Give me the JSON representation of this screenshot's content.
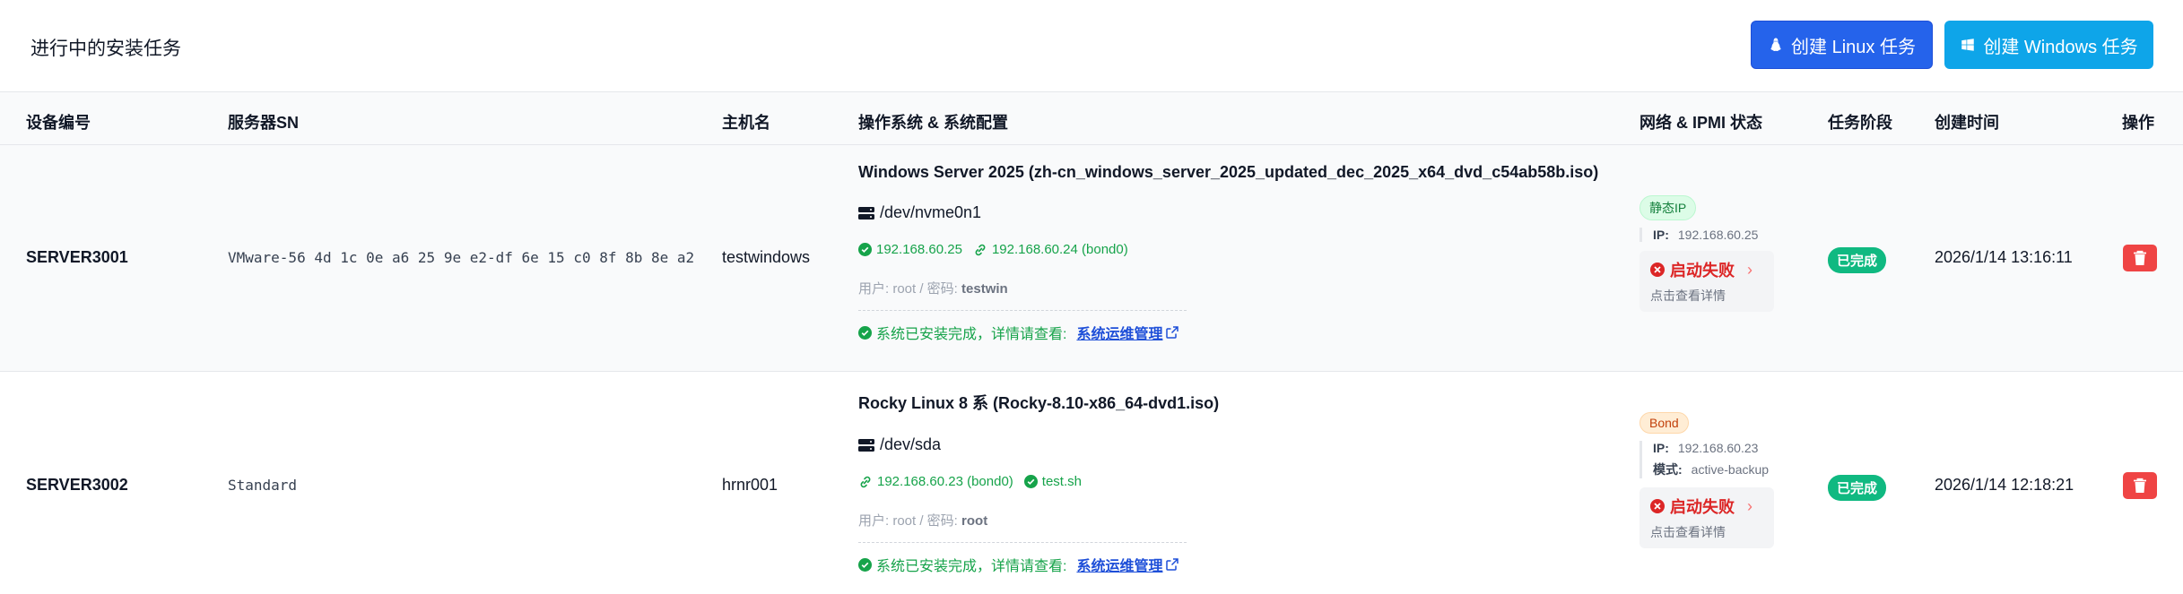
{
  "header": {
    "title": "进行中的安装任务",
    "create_linux_label": "创建 Linux 任务",
    "create_windows_label": "创建 Windows 任务"
  },
  "columns": [
    "设备编号",
    "服务器SN",
    "主机名",
    "操作系统 & 系统配置",
    "网络 & IPMI 状态",
    "任务阶段",
    "创建时间",
    "操作"
  ],
  "rows": [
    {
      "device_id": "SERVER3001",
      "sn": "VMware-56 4d 1c 0e a6 25 9e e2-df 6e 15 c0 8f 8b 8e a2",
      "hostname": "testwindows",
      "os_title": "Windows Server 2025 (zh-cn_windows_server_2025_updated_dec_2025_x64_dvd_c54ab58b.iso)",
      "disk": "/dev/nvme0n1",
      "ip": "192.168.60.25",
      "bond_ip": "192.168.60.24 (bond0)",
      "cred_prefix": "用户: root / 密码:",
      "password": "testwin",
      "done_text": "系统已安装完成，详情请查看:",
      "done_link": "系统运维管理",
      "net_mode": "静态IP",
      "ipmi_ip_label": "IP:",
      "ipmi_ip": "192.168.60.25",
      "boot_status": "启动失败",
      "boot_detail": "点击查看详情",
      "stage": "已完成",
      "created": "2026/1/14 13:16:11"
    },
    {
      "device_id": "SERVER3002",
      "sn": "Standard",
      "hostname": "hrnr001",
      "os_title": "Rocky Linux 8 系 (Rocky-8.10-x86_64-dvd1.iso)",
      "disk": "/dev/sda",
      "bond_ip": "192.168.60.23 (bond0)",
      "script": "test.sh",
      "cred_prefix": "用户: root / 密码:",
      "password": "root",
      "done_text": "系统已安装完成，详情请查看:",
      "done_link": "系统运维管理",
      "net_mode": "Bond",
      "ipmi_ip_label": "IP:",
      "ipmi_ip": "192.168.60.23",
      "ipmi_mode_label": "模式:",
      "ipmi_mode": "active-backup",
      "boot_status": "启动失败",
      "boot_detail": "点击查看详情",
      "stage": "已完成",
      "created": "2026/1/14 12:18:21"
    }
  ],
  "colors": {
    "primary": "#2563eb",
    "sky": "#0ea5e9",
    "success": "#10b981",
    "danger": "#ef4444",
    "link": "#1d4ed8"
  },
  "icons": [
    "linux-icon",
    "windows-icon",
    "disk-icon",
    "check-circle-icon",
    "link-icon",
    "external-link-icon",
    "error-icon",
    "chevron-right-icon",
    "trash-icon"
  ]
}
